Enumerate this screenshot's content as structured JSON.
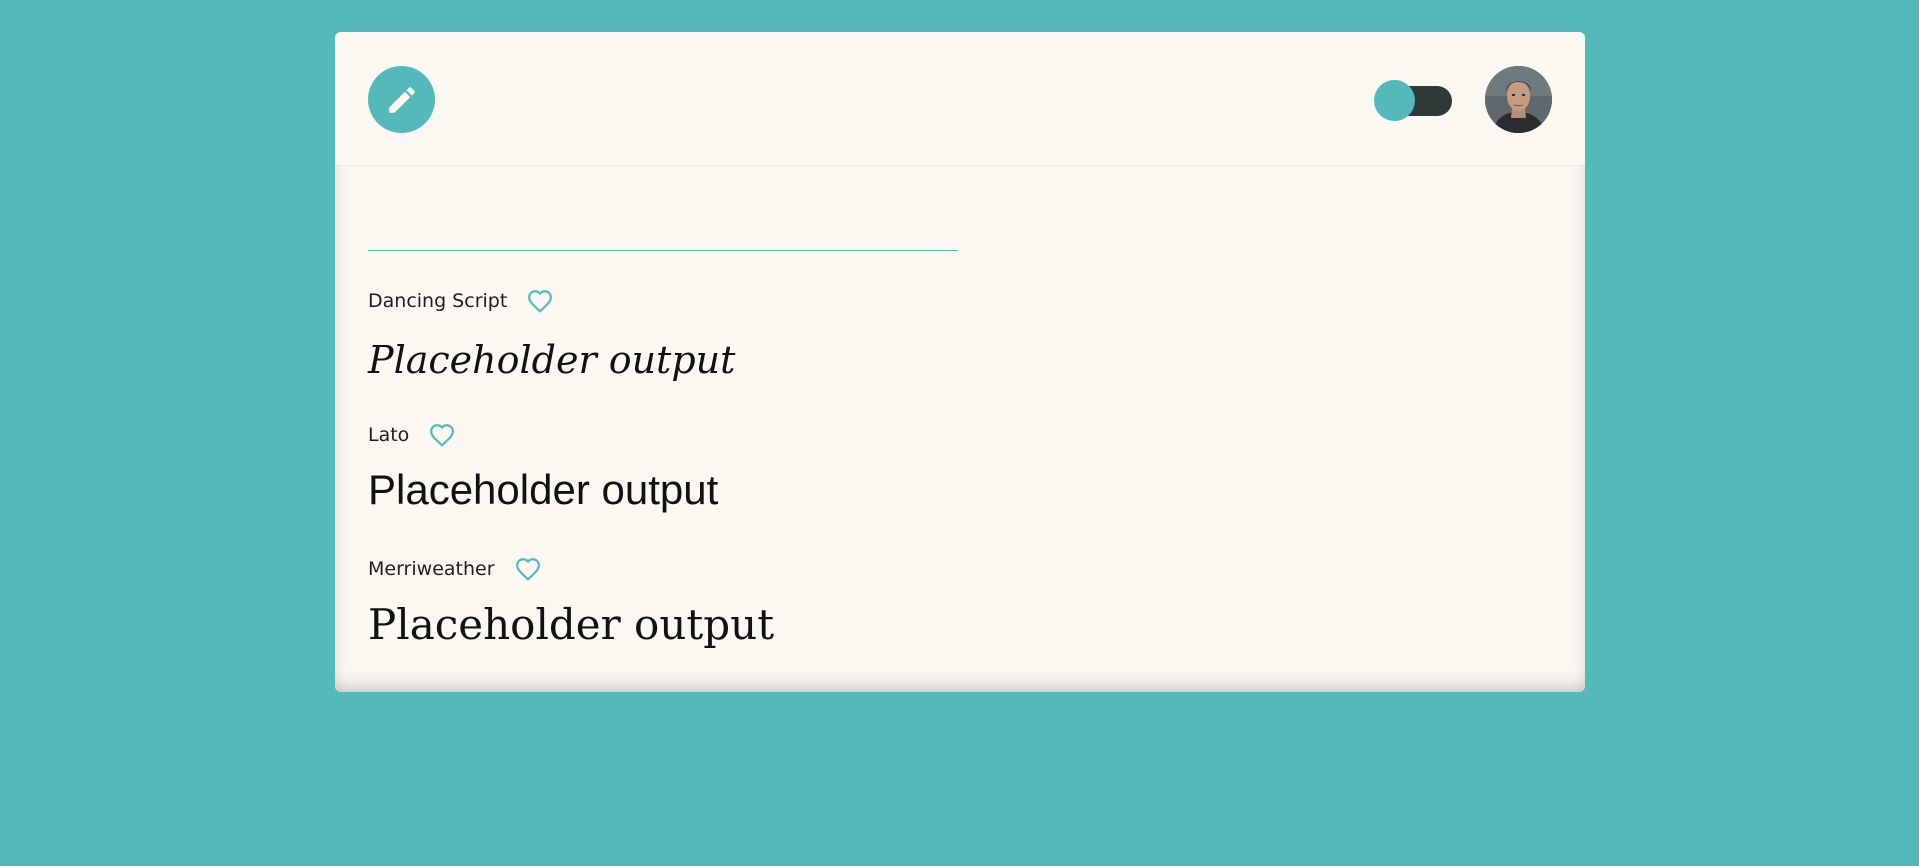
{
  "header": {
    "edit_icon": "pencil-icon",
    "toggle": {
      "state": "off"
    },
    "avatar_icon": "user-avatar"
  },
  "input": {
    "value": "",
    "placeholder": ""
  },
  "fonts": [
    {
      "name": "Dancing Script",
      "favorite_icon": "heart-outline-icon",
      "sample": "Placeholder output"
    },
    {
      "name": "Lato",
      "favorite_icon": "heart-outline-icon",
      "sample": "Placeholder output"
    },
    {
      "name": "Merriweather",
      "favorite_icon": "heart-outline-icon",
      "sample": "Placeholder output"
    }
  ],
  "colors": {
    "accent": "#54b9b8",
    "card": "#faf8f1",
    "toggle_track": "#2d3a37"
  }
}
